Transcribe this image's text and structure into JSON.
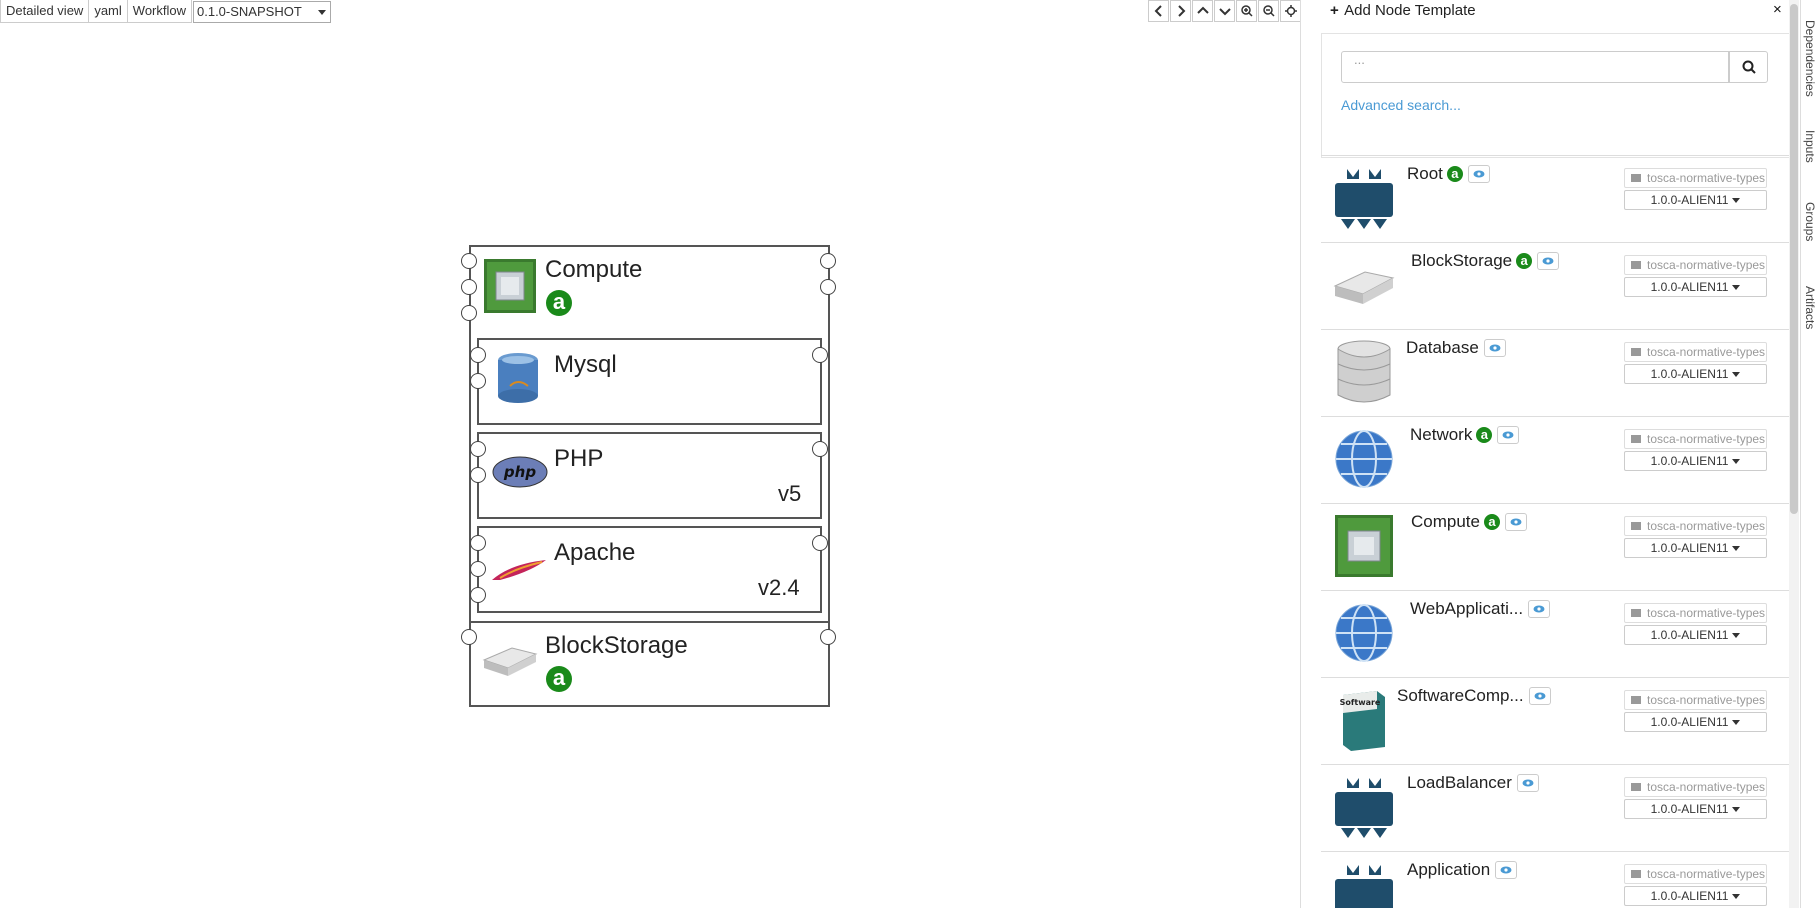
{
  "toolbar": {
    "detailed_view": "Detailed view",
    "yaml": "yaml",
    "workflow": "Workflow",
    "version_select": "0.1.0-SNAPSHOT"
  },
  "canvas": {
    "compute": {
      "label": "Compute",
      "badge": "a"
    },
    "mysql": {
      "label": "Mysql"
    },
    "php": {
      "label": "PHP",
      "version": "v5"
    },
    "apache": {
      "label": "Apache",
      "version": "v2.4"
    },
    "blockstorage": {
      "label": "BlockStorage",
      "badge": "a"
    }
  },
  "panel": {
    "title": "Add Node Template",
    "close": "×",
    "search_placeholder": "...",
    "advanced_search": "Advanced search...",
    "items": [
      {
        "name": "Root",
        "badge": "a",
        "repo": "tosca-normative-types",
        "version": "1.0.0-ALIEN11",
        "icon": "root-icon"
      },
      {
        "name": "BlockStorage",
        "badge": "a",
        "repo": "tosca-normative-types",
        "version": "1.0.0-ALIEN11",
        "icon": "blockstorage-icon"
      },
      {
        "name": "Database",
        "badge": "",
        "repo": "tosca-normative-types",
        "version": "1.0.0-ALIEN11",
        "icon": "database-icon"
      },
      {
        "name": "Network",
        "badge": "a",
        "repo": "tosca-normative-types",
        "version": "1.0.0-ALIEN11",
        "icon": "globe-icon"
      },
      {
        "name": "Compute",
        "badge": "a",
        "repo": "tosca-normative-types",
        "version": "1.0.0-ALIEN11",
        "icon": "chip-icon"
      },
      {
        "name": "WebApplicati...",
        "badge": "",
        "repo": "tosca-normative-types",
        "version": "1.0.0-ALIEN11",
        "icon": "globe-icon"
      },
      {
        "name": "SoftwareComp...",
        "badge": "",
        "repo": "tosca-normative-types",
        "version": "1.0.0-ALIEN11",
        "icon": "software-box-icon"
      },
      {
        "name": "LoadBalancer",
        "badge": "",
        "repo": "tosca-normative-types",
        "version": "1.0.0-ALIEN11",
        "icon": "root-icon"
      },
      {
        "name": "Application",
        "badge": "",
        "repo": "tosca-normative-types",
        "version": "1.0.0-ALIEN11",
        "icon": "root-icon"
      }
    ]
  },
  "side_tabs": [
    "Dependencies",
    "Inputs",
    "Groups",
    "Artifacts"
  ],
  "colors": {
    "accent": "#4a9ad4",
    "badge_green": "#1a8a1a",
    "root_icon": "#1f4d6b"
  }
}
